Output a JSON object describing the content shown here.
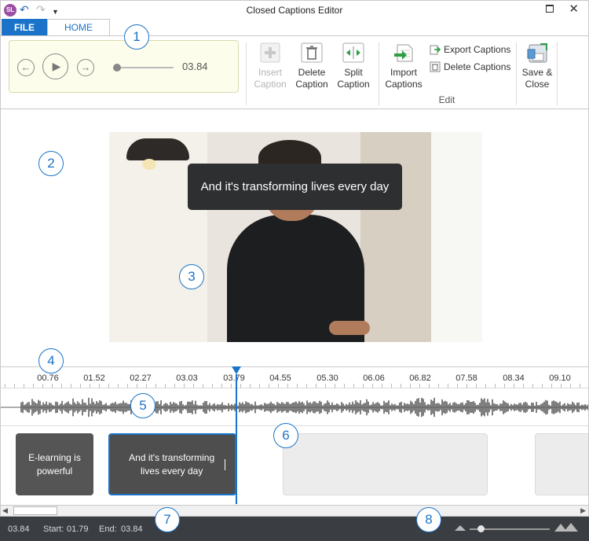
{
  "window": {
    "title": "Closed Captions Editor",
    "logo_text": "SL"
  },
  "tabs": {
    "file": "FILE",
    "home": "HOME"
  },
  "player": {
    "current_time": "03.84"
  },
  "ribbon": {
    "insert_caption": [
      "Insert",
      "Caption"
    ],
    "delete_caption": [
      "Delete",
      "Caption"
    ],
    "split_caption": [
      "Split",
      "Caption"
    ],
    "import_captions": [
      "Import",
      "Captions"
    ],
    "export_captions": "Export Captions",
    "delete_captions": "Delete Captions",
    "edit_group_label": "Edit",
    "save_close": [
      "Save &",
      "Close"
    ]
  },
  "preview": {
    "overlay_caption": "And it's transforming lives every day"
  },
  "callouts": [
    "1",
    "2",
    "3",
    "4",
    "5",
    "6",
    "7",
    "8"
  ],
  "timeline": {
    "ticks": [
      "00.76",
      "01.52",
      "02.27",
      "03.03",
      "03.79",
      "04.55",
      "05.30",
      "06.06",
      "06.82",
      "07.58",
      "08.34",
      "09.10"
    ],
    "playhead_time": 3.84
  },
  "captions": [
    {
      "text": "E-learning is powerful",
      "state": "normal"
    },
    {
      "text": "And it's transforming lives every day",
      "state": "selected"
    },
    {
      "text": "",
      "state": "empty"
    },
    {
      "text": "",
      "state": "empty"
    }
  ],
  "status": {
    "position": "03.84",
    "start_label": "Start:",
    "start_value": "01.79",
    "end_label": "End:",
    "end_value": "03.84"
  },
  "colors": {
    "accent": "#1a73c8",
    "status_bar": "#3a3d42",
    "player_bg": "#fdfdeb",
    "caption_block": "#555555"
  }
}
